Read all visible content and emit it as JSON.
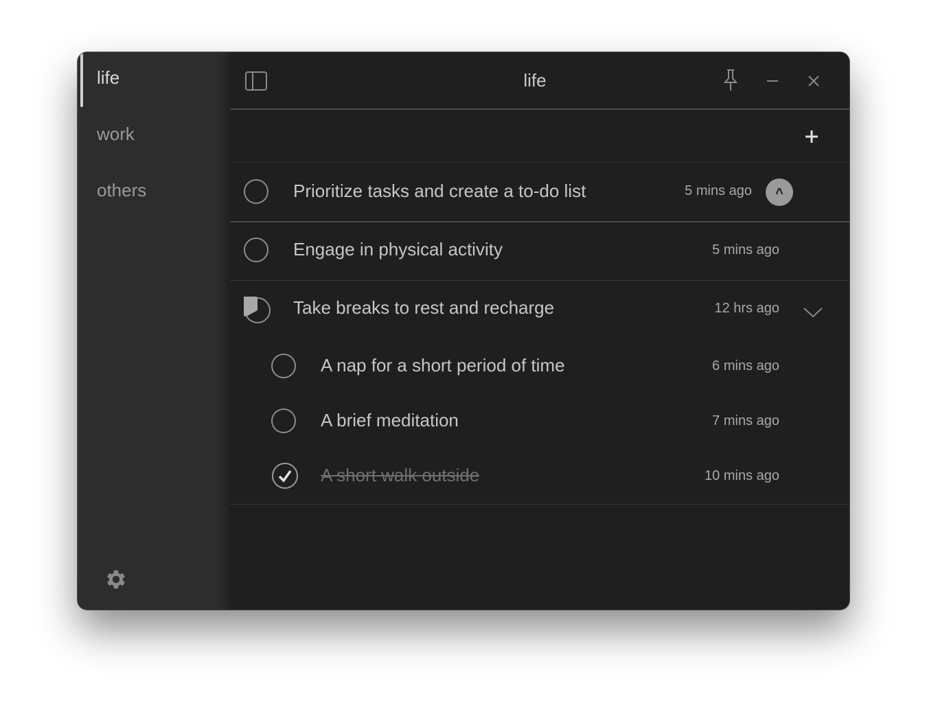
{
  "sidebar": {
    "items": [
      {
        "label": "life",
        "active": true
      },
      {
        "label": "work",
        "active": false
      },
      {
        "label": "others",
        "active": false
      }
    ],
    "settings_icon": "gear-icon"
  },
  "header": {
    "title": "life",
    "sidebar_toggle_icon": "sidebar-toggle-icon",
    "pin_icon": "pin-icon",
    "minimize_icon": "minimize-icon",
    "close_icon": "close-icon"
  },
  "add_bar": {
    "icon": "plus-icon"
  },
  "tasks": [
    {
      "text": "Prioritize tasks and create a to-do list",
      "time": "5 mins ago",
      "status": "open",
      "collapse_label": "^"
    },
    {
      "text": "Engage in physical activity",
      "time": "5 mins ago",
      "status": "open"
    },
    {
      "text": "Take breaks to rest and recharge",
      "time": "12 hrs ago",
      "status": "partial",
      "progress": 0.33,
      "subtasks": [
        {
          "text": "A nap for a short period of time",
          "time": "6 mins ago",
          "status": "open"
        },
        {
          "text": "A brief meditation",
          "time": "7 mins ago",
          "status": "open"
        },
        {
          "text": "A short walk outside",
          "time": "10 mins ago",
          "status": "done"
        }
      ]
    }
  ],
  "colors": {
    "background": "#1f1f1f",
    "sidebar": "#2d2d2d",
    "text": "#c6c6c6"
  }
}
